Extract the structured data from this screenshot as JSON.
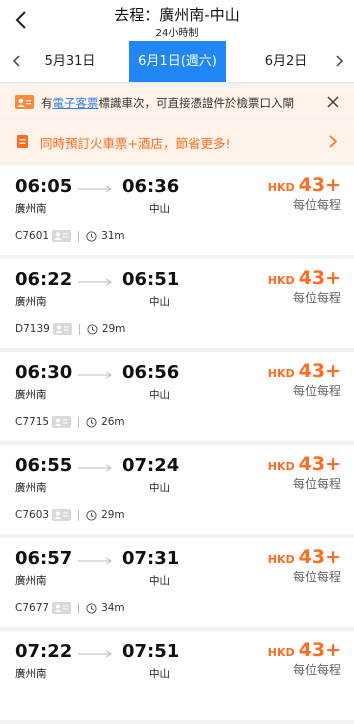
{
  "header": {
    "title": "去程：廣州南-中山",
    "subtitle": "24小時制"
  },
  "dates": [
    {
      "label": "5月31日",
      "active": false
    },
    {
      "label": "6月1日(週六)",
      "active": true
    },
    {
      "label": "6月2日",
      "active": false
    }
  ],
  "notice": {
    "prefix": "有",
    "link": "電子客票",
    "suffix": "標識車次，可直接憑證件於檢票口入閘"
  },
  "promo": {
    "text": "同時預訂火車票+酒店，節省更多!"
  },
  "trains": [
    {
      "dep": "06:05",
      "arr": "06:36",
      "from": "廣州南",
      "to": "中山",
      "no": "C7601",
      "dur": "31m",
      "currency": "HKD",
      "price": "43+",
      "per": "每位每程"
    },
    {
      "dep": "06:22",
      "arr": "06:51",
      "from": "廣州南",
      "to": "中山",
      "no": "D7139",
      "dur": "29m",
      "currency": "HKD",
      "price": "43+",
      "per": "每位每程"
    },
    {
      "dep": "06:30",
      "arr": "06:56",
      "from": "廣州南",
      "to": "中山",
      "no": "C7715",
      "dur": "26m",
      "currency": "HKD",
      "price": "43+",
      "per": "每位每程"
    },
    {
      "dep": "06:55",
      "arr": "07:24",
      "from": "廣州南",
      "to": "中山",
      "no": "C7603",
      "dur": "29m",
      "currency": "HKD",
      "price": "43+",
      "per": "每位每程"
    },
    {
      "dep": "06:57",
      "arr": "07:31",
      "from": "廣州南",
      "to": "中山",
      "no": "C7677",
      "dur": "34m",
      "currency": "HKD",
      "price": "43+",
      "per": "每位每程"
    },
    {
      "dep": "07:22",
      "arr": "07:51",
      "from": "廣州南",
      "to": "中山",
      "no": "",
      "dur": "",
      "currency": "HKD",
      "price": "43+",
      "per": "每位每程"
    }
  ],
  "colors": {
    "accent": "#2187f5",
    "price": "#ff6c22",
    "notice_bg": "#fff3e9"
  },
  "icons": [
    "back-arrow-icon",
    "chevron-left-icon",
    "chevron-right-icon",
    "ticket-badge-icon",
    "close-icon",
    "document-icon",
    "id-card-icon",
    "clock-icon",
    "arrow-right-icon"
  ]
}
